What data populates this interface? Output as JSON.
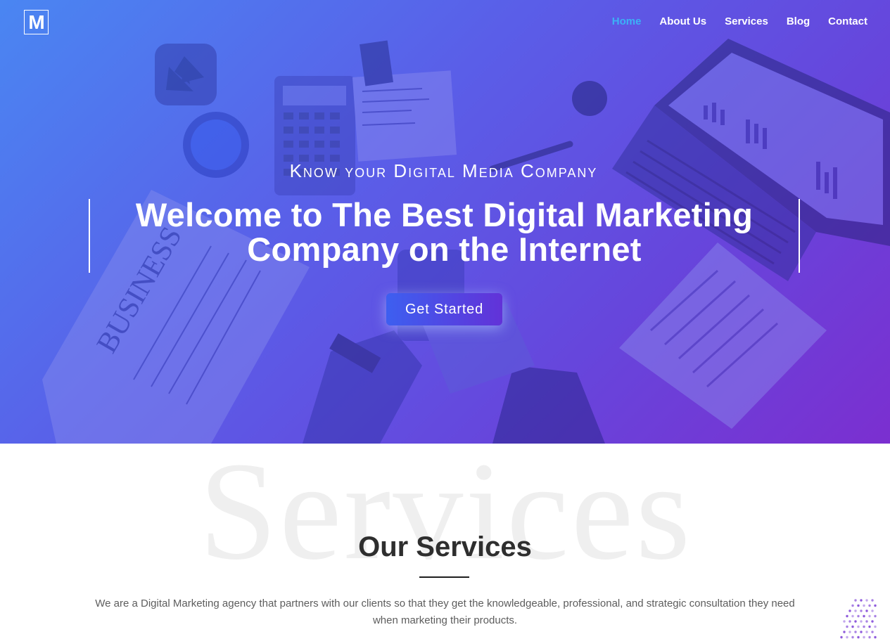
{
  "header": {
    "logo_letter": "M",
    "nav": [
      {
        "label": "Home",
        "active": true
      },
      {
        "label": "About Us",
        "active": false
      },
      {
        "label": "Services",
        "active": false
      },
      {
        "label": "Blog",
        "active": false
      },
      {
        "label": "Contact",
        "active": false
      }
    ]
  },
  "hero": {
    "eyebrow": "Know your Digital Media Company",
    "headline_line1": "Welcome to The Best Digital Marketing",
    "headline_line2": "Company on the Internet",
    "cta_label": "Get Started",
    "newspaper_text": "BUSINESS"
  },
  "services": {
    "background_word": "Services",
    "title": "Our Services",
    "description": "We are a Digital Marketing agency that partners with our clients so that they get the knowledgeable, professional, and strategic consultation they need when marketing their products."
  },
  "colors": {
    "nav_active": "#3cb1f6",
    "gradient_start": "#4a86f2",
    "gradient_end": "#7b2fd0",
    "accent_dots": "#7b3fd6"
  }
}
